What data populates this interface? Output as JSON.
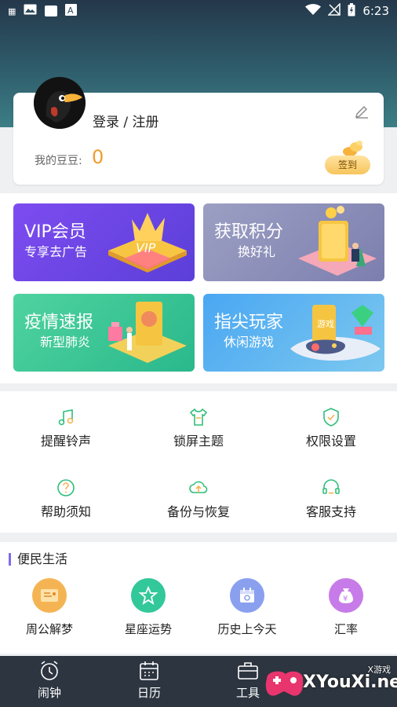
{
  "status_bar": {
    "time": "6:23"
  },
  "profile": {
    "login_label": "登录 / 注册",
    "beans_label": "我的豆豆:",
    "beans_value": "0",
    "checkin_label": "签到"
  },
  "banners": [
    {
      "title": "VIP会员",
      "subtitle": "专享去广告"
    },
    {
      "title": "获取积分",
      "subtitle": "换好礼"
    },
    {
      "title": "疫情速报",
      "subtitle": "新型肺炎"
    },
    {
      "title": "指尖玩家",
      "subtitle": "休闲游戏"
    }
  ],
  "tools": [
    {
      "label": "提醒铃声",
      "icon": "music-note-icon"
    },
    {
      "label": "锁屏主题",
      "icon": "shirt-icon"
    },
    {
      "label": "权限设置",
      "icon": "shield-icon"
    },
    {
      "label": "帮助须知",
      "icon": "question-icon"
    },
    {
      "label": "备份与恢复",
      "icon": "cloud-sync-icon"
    },
    {
      "label": "客服支持",
      "icon": "headset-icon"
    }
  ],
  "life": {
    "title": "便民生活",
    "items": [
      {
        "label": "周公解梦",
        "color": "#f5b454"
      },
      {
        "label": "星座运势",
        "color": "#32c89a"
      },
      {
        "label": "历史上今天",
        "color": "#8aa0ef"
      },
      {
        "label": "汇率",
        "color": "#c77be8"
      }
    ]
  },
  "bottom_nav": [
    {
      "label": "闹钟",
      "icon": "alarm-clock-icon"
    },
    {
      "label": "日历",
      "icon": "calendar-icon"
    },
    {
      "label": "工具",
      "icon": "toolbox-icon"
    }
  ],
  "watermark": {
    "main": "XYouXi.net",
    "small": "X游戏"
  },
  "colors": {
    "accent": "#f39b2d",
    "nav_bg": "#2c3540",
    "header": "#2f5d6c"
  }
}
